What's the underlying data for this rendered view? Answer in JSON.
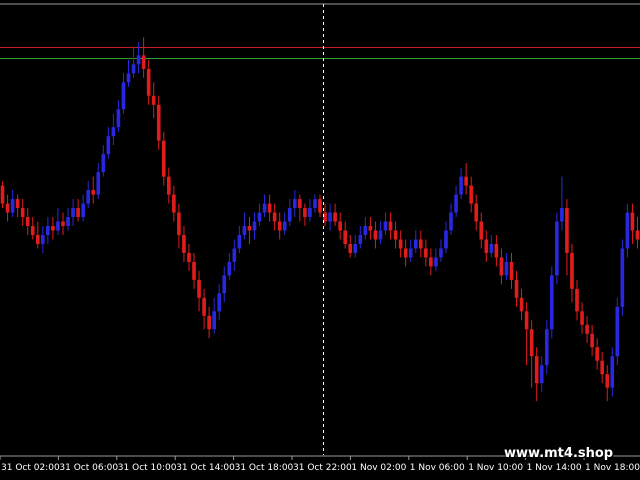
{
  "watermark": "www.mt4.shop",
  "colors": {
    "background": "#000000",
    "bull": "#2828e0",
    "bear": "#e01c1c",
    "doji": "#2ccc2c",
    "resistance_line": "#c81e1e",
    "support_line": "#2e9e2e",
    "crosshair": "#ffffff",
    "axis_text": "#ffffff",
    "frame": "#9a9a9a"
  },
  "chart_data": {
    "type": "candlestick",
    "x_tick_labels": [
      "31 Oct 02:00",
      "31 Oct 06:00",
      "31 Oct 10:00",
      "31 Oct 14:00",
      "31 Oct 18:00",
      "31 Oct 22:00",
      "1 Nov 02:00",
      "1 Nov 06:00",
      "1 Nov 10:00",
      "1 Nov 14:00",
      "1 Nov 18:00"
    ],
    "y_range": [
      0,
      100
    ],
    "horizontal_lines": [
      {
        "value": 90.8,
        "color": "#c81e1e"
      },
      {
        "value": 88.4,
        "color": "#2e9e2e"
      }
    ],
    "crosshair_x_label": "31 Oct 22:00",
    "candles": [
      [
        60,
        56,
        61,
        55
      ],
      [
        56,
        54,
        58,
        52
      ],
      [
        54,
        57,
        59,
        53
      ],
      [
        57,
        55,
        58,
        53
      ],
      [
        55,
        53,
        57,
        51
      ],
      [
        53,
        51,
        55,
        49
      ],
      [
        51,
        49,
        53,
        48
      ],
      [
        49,
        47,
        52,
        46
      ],
      [
        47,
        49,
        51,
        45
      ],
      [
        49,
        51,
        53,
        47
      ],
      [
        51,
        50,
        53,
        48
      ],
      [
        50,
        52,
        55,
        49
      ],
      [
        52,
        51,
        54,
        49
      ],
      [
        51,
        53,
        55,
        50
      ],
      [
        53,
        55,
        57,
        51
      ],
      [
        55,
        53,
        57,
        52
      ],
      [
        53,
        56,
        58,
        52
      ],
      [
        56,
        59,
        61,
        55
      ],
      [
        59,
        58,
        62,
        56
      ],
      [
        58,
        63,
        65,
        57
      ],
      [
        63,
        67,
        69,
        62
      ],
      [
        67,
        71,
        73,
        66
      ],
      [
        71,
        73,
        76,
        69
      ],
      [
        73,
        77,
        79,
        72
      ],
      [
        77,
        83,
        85,
        76
      ],
      [
        83,
        85,
        88,
        82
      ],
      [
        85,
        87,
        91,
        84
      ],
      [
        87,
        89,
        92,
        85
      ],
      [
        89,
        86,
        93,
        84
      ],
      [
        86,
        80,
        88,
        78
      ],
      [
        80,
        78,
        83,
        75
      ],
      [
        78,
        70,
        80,
        68
      ],
      [
        70,
        62,
        72,
        60
      ],
      [
        62,
        58,
        64,
        56
      ],
      [
        58,
        54,
        60,
        52
      ],
      [
        54,
        49,
        56,
        46
      ],
      [
        49,
        45,
        51,
        43
      ],
      [
        45,
        43,
        47,
        41
      ],
      [
        43,
        39,
        45,
        37
      ],
      [
        39,
        35,
        41,
        32
      ],
      [
        35,
        31,
        37,
        28
      ],
      [
        31,
        28,
        33,
        26
      ],
      [
        28,
        32,
        35,
        27
      ],
      [
        32,
        36,
        38,
        30
      ],
      [
        36,
        40,
        42,
        34
      ],
      [
        40,
        43,
        45,
        39
      ],
      [
        43,
        46,
        48,
        41
      ],
      [
        46,
        49,
        51,
        45
      ],
      [
        49,
        51,
        54,
        48
      ],
      [
        51,
        50,
        53,
        47
      ],
      [
        50,
        52,
        54,
        48
      ],
      [
        52,
        54,
        56,
        51
      ],
      [
        54,
        56,
        58,
        53
      ],
      [
        56,
        54,
        58,
        52
      ],
      [
        54,
        52,
        56,
        50
      ],
      [
        52,
        50,
        54,
        48
      ],
      [
        50,
        52,
        54,
        49
      ],
      [
        52,
        55,
        57,
        51
      ],
      [
        55,
        57,
        59,
        53
      ],
      [
        57,
        55,
        58,
        52
      ],
      [
        55,
        53,
        56,
        51
      ],
      [
        53,
        55,
        57,
        52
      ],
      [
        55,
        57,
        58,
        54
      ],
      [
        57,
        54,
        58,
        53
      ],
      [
        54,
        52,
        56,
        51
      ],
      [
        52,
        54,
        56,
        50
      ],
      [
        54,
        52,
        56,
        51
      ],
      [
        52,
        50,
        54,
        48
      ],
      [
        50,
        47,
        52,
        46
      ],
      [
        47,
        45,
        49,
        44
      ],
      [
        45,
        47,
        49,
        44
      ],
      [
        47,
        49,
        51,
        46
      ],
      [
        49,
        51,
        53,
        48
      ],
      [
        51,
        50,
        53,
        48
      ],
      [
        50,
        48,
        52,
        46
      ],
      [
        48,
        50,
        52,
        47
      ],
      [
        50,
        52,
        54,
        49
      ],
      [
        52,
        50,
        54,
        48
      ],
      [
        50,
        48,
        52,
        46
      ],
      [
        48,
        46,
        50,
        44
      ],
      [
        46,
        44,
        48,
        42
      ],
      [
        44,
        46,
        48,
        43
      ],
      [
        46,
        48,
        50,
        45
      ],
      [
        48,
        46,
        50,
        44
      ],
      [
        46,
        44,
        48,
        42
      ],
      [
        44,
        42,
        46,
        40
      ],
      [
        42,
        44,
        46,
        41
      ],
      [
        44,
        46,
        48,
        43
      ],
      [
        46,
        50,
        52,
        45
      ],
      [
        50,
        54,
        56,
        49
      ],
      [
        54,
        58,
        60,
        53
      ],
      [
        58,
        62,
        64,
        57
      ],
      [
        62,
        60,
        65,
        58
      ],
      [
        60,
        56,
        62,
        54
      ],
      [
        56,
        52,
        58,
        50
      ],
      [
        52,
        48,
        54,
        46
      ],
      [
        48,
        45,
        50,
        43
      ],
      [
        45,
        47,
        49,
        44
      ],
      [
        47,
        44,
        49,
        42
      ],
      [
        44,
        40,
        46,
        38
      ],
      [
        40,
        43,
        45,
        39
      ],
      [
        43,
        39,
        45,
        37
      ],
      [
        39,
        35,
        41,
        33
      ],
      [
        35,
        32,
        37,
        30
      ],
      [
        32,
        28,
        34,
        20
      ],
      [
        28,
        22,
        30,
        15
      ],
      [
        22,
        16,
        24,
        12
      ],
      [
        16,
        20,
        22,
        14
      ],
      [
        20,
        28,
        30,
        18
      ],
      [
        28,
        40,
        42,
        26
      ],
      [
        40,
        52,
        54,
        38
      ],
      [
        52,
        55,
        62,
        50
      ],
      [
        55,
        45,
        57,
        40
      ],
      [
        45,
        37,
        47,
        34
      ],
      [
        37,
        32,
        39,
        30
      ],
      [
        32,
        29,
        34,
        27
      ],
      [
        29,
        27,
        31,
        25
      ],
      [
        27,
        24,
        29,
        22
      ],
      [
        24,
        21,
        26,
        19
      ],
      [
        21,
        18,
        23,
        16
      ],
      [
        18,
        15,
        20,
        12
      ],
      [
        15,
        22,
        24,
        13
      ],
      [
        22,
        33,
        35,
        20
      ],
      [
        33,
        46,
        48,
        31
      ],
      [
        46,
        54,
        56,
        44
      ],
      [
        54,
        50,
        56,
        47
      ],
      [
        50,
        48,
        53,
        46
      ]
    ]
  }
}
